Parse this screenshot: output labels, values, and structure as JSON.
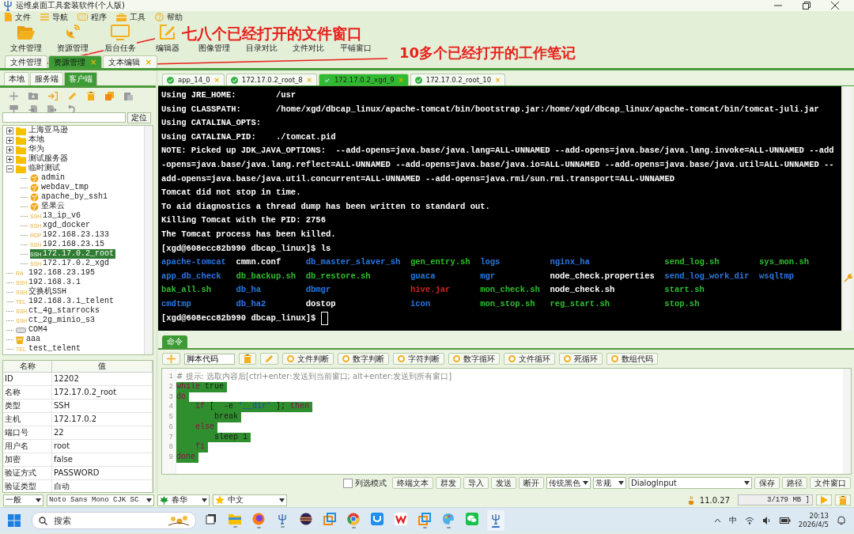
{
  "window": {
    "title": "运维桌面工具套装软件(个人版)"
  },
  "menu": [
    "文件",
    "导航",
    "程序",
    "工具",
    "帮助"
  ],
  "toolbar": [
    "文件管理",
    "资源管理",
    "后台任务",
    "编辑器",
    "图像管理",
    "目录对比",
    "文件对比",
    "平铺窗口"
  ],
  "doc_tabs": [
    {
      "label": "文件管理",
      "selected": false
    },
    {
      "label": "资源管理",
      "selected": true,
      "close": "×"
    },
    {
      "label": "文本编辑",
      "selected": false,
      "close": "×"
    }
  ],
  "annotations": [
    "七八个已经打开的文件窗口",
    "10多个已经打开的工作笔记"
  ],
  "left_panel": {
    "tabs": [
      {
        "label": "本地",
        "selected": false
      },
      {
        "label": "服务端",
        "selected": false
      },
      {
        "label": "客户端",
        "selected": true
      }
    ],
    "locate_button": "定位",
    "tree": [
      {
        "label": "上海亚马逊",
        "kind": "folder",
        "expanded": false,
        "selected": false
      },
      {
        "label": "本地",
        "kind": "folder",
        "expanded": false,
        "selected": false
      },
      {
        "label": "华为",
        "kind": "folder",
        "expanded": false,
        "selected": false
      },
      {
        "label": "测试服务器",
        "kind": "folder",
        "expanded": false,
        "selected": false
      },
      {
        "label": "临时测试",
        "kind": "folder",
        "expanded": true,
        "selected": false,
        "children": [
          {
            "label": "admin",
            "kind": "web",
            "selected": false
          },
          {
            "label": "webdav_tmp",
            "kind": "web",
            "selected": false
          },
          {
            "label": "apache_by_ssh1",
            "kind": "web",
            "selected": false
          },
          {
            "label": "坚果云",
            "kind": "web",
            "selected": false
          },
          {
            "label": "13_ip_v6",
            "kind": "tag",
            "tag": "SSH",
            "selected": false
          },
          {
            "label": "xgd_docker",
            "kind": "tag",
            "tag": "SSH",
            "selected": false
          },
          {
            "label": "192.168.23.133",
            "kind": "tag",
            "tag": "RDP",
            "selected": false
          },
          {
            "label": "192.168.23.15",
            "kind": "tag",
            "tag": "SSH",
            "selected": false
          },
          {
            "label": "172.17.0.2_root",
            "kind": "tag",
            "tag": "SSH",
            "selected": true
          },
          {
            "label": "172.17.0.2_xgd",
            "kind": "tag",
            "tag": "SSH",
            "selected": false
          }
        ]
      },
      {
        "label": "192.168.23.195",
        "kind": "tag",
        "tag": "RA",
        "selected": false
      },
      {
        "label": "192.168.3.1",
        "kind": "tag",
        "tag": "SSH",
        "selected": false
      },
      {
        "label": "交换机SSH",
        "kind": "tag",
        "tag": "SSH",
        "selected": false
      },
      {
        "label": "192.168.3.1_telent",
        "kind": "tag",
        "tag": "TEL",
        "selected": false
      },
      {
        "label": "ct_4g_starrocks",
        "kind": "tag",
        "tag": "SSH",
        "selected": false
      },
      {
        "label": "ct_2g_minio_s3",
        "kind": "tag",
        "tag": "SSH",
        "selected": false
      },
      {
        "label": "COM4",
        "kind": "serial",
        "selected": false
      },
      {
        "label": "aaa",
        "kind": "db",
        "selected": false
      },
      {
        "label": "test_telent",
        "kind": "tag",
        "tag": "TEL",
        "selected": false
      }
    ],
    "properties": {
      "columns": [
        "名称",
        "值"
      ],
      "rows": [
        [
          "ID",
          "12202"
        ],
        [
          "名称",
          "172.17.0.2_root"
        ],
        [
          "类型",
          "SSH"
        ],
        [
          "主机",
          "172.17.0.2"
        ],
        [
          "端口号",
          "22"
        ],
        [
          "用户名",
          "root"
        ],
        [
          "加密",
          "false"
        ],
        [
          "验证方式",
          "PASSWORD"
        ],
        [
          "验证类型",
          "自动"
        ]
      ]
    }
  },
  "session_tabs": [
    {
      "label": "app_14_0",
      "selected": false,
      "close": "×"
    },
    {
      "label": "172.17.0.2_root_8",
      "selected": false,
      "close": "×"
    },
    {
      "label": "172.17.0.2_xgd_9",
      "selected": true,
      "close": "×"
    },
    {
      "label": "172.17.0.2_root_10",
      "selected": false,
      "close": "×"
    }
  ],
  "terminal": {
    "lines": [
      "Using JRE_HOME:        /usr",
      "Using CLASSPATH:       /home/xgd/dbcap_linux/apache-tomcat/bin/bootstrap.jar:/home/xgd/dbcap_linux/apache-tomcat/bin/tomcat-juli.jar",
      "Using CATALINA_OPTS:",
      "Using CATALINA_PID:    ./tomcat.pid",
      "NOTE: Picked up JDK_JAVA_OPTIONS:  --add-opens=java.base/java.lang=ALL-UNNAMED --add-opens=java.base/java.lang.invoke=ALL-UNNAMED --add",
      "-opens=java.base/java.lang.reflect=ALL-UNNAMED --add-opens=java.base/java.io=ALL-UNNAMED --add-opens=java.base/java.util=ALL-UNNAMED --",
      "add-opens=java.base/java.util.concurrent=ALL-UNNAMED --add-opens=java.rmi/sun.rmi.transport=ALL-UNNAMED",
      "Tomcat did not stop in time.",
      "To aid diagnostics a thread dump has been written to standard out.",
      "Killing Tomcat with the PID: 2756",
      "The Tomcat process has been killed.",
      "[xgd@608ecc82b990 dbcap_linux]$ ls"
    ],
    "listing": [
      [
        {
          "name": "apache-tomcat",
          "color": "#2a78e4"
        },
        {
          "name": "cmmn.conf",
          "color": "#ffffff"
        },
        {
          "name": "db_master_slaver_sh",
          "color": "#2a78e4"
        },
        {
          "name": "gen_entry.sh",
          "color": "#2fbf2f"
        },
        {
          "name": "logs",
          "color": "#2a78e4"
        },
        {
          "name": "nginx_ha",
          "color": "#2a78e4"
        },
        {
          "name": "send_log.sh",
          "color": "#2fbf2f"
        },
        {
          "name": "sys_mon.sh",
          "color": "#2fbf2f"
        }
      ],
      [
        {
          "name": "app_db_check",
          "color": "#2a78e4"
        },
        {
          "name": "db_backup.sh",
          "color": "#2fbf2f"
        },
        {
          "name": "db_restore.sh",
          "color": "#2fbf2f"
        },
        {
          "name": "guaca",
          "color": "#2a78e4"
        },
        {
          "name": "mgr",
          "color": "#2a78e4"
        },
        {
          "name": "node_check.properties",
          "color": "#ffffff"
        },
        {
          "name": "send_log_work_dir",
          "color": "#2a78e4"
        },
        {
          "name": "wsqltmp",
          "color": "#2a78e4"
        }
      ],
      [
        {
          "name": "bak_all.sh",
          "color": "#2fbf2f"
        },
        {
          "name": "db_ha",
          "color": "#2a78e4"
        },
        {
          "name": "dbmgr",
          "color": "#2a78e4"
        },
        {
          "name": "hive.jar",
          "color": "#d42020"
        },
        {
          "name": "mon_check.sh",
          "color": "#2fbf2f"
        },
        {
          "name": "node_check.sh",
          "color": "#ffffff"
        },
        {
          "name": "start.sh",
          "color": "#2fbf2f"
        }
      ],
      [
        {
          "name": "cmdtmp",
          "color": "#2a78e4"
        },
        {
          "name": "db_ha2",
          "color": "#2a78e4"
        },
        {
          "name": "dostop",
          "color": "#ffffff"
        },
        {
          "name": "icon",
          "color": "#2a78e4"
        },
        {
          "name": "mon_stop.sh",
          "color": "#2fbf2f"
        },
        {
          "name": "reg_start.sh",
          "color": "#2fbf2f"
        },
        {
          "name": "stop.sh",
          "color": "#2fbf2f"
        }
      ]
    ],
    "prompt": "[xgd@608ecc82b990 dbcap_linux]$ "
  },
  "command": {
    "tab": "命令",
    "script_field": "脚本代码",
    "snippets": [
      "文件判断",
      "数字判断",
      "字符判断",
      "数字循环",
      "文件循环",
      "死循环",
      "数组代码"
    ],
    "code": [
      {
        "number": "1",
        "selected": false,
        "tokens": [
          {
            "text": "# 提示: 选取内容后[ctrl+enter:发送到当前窗口; alt+enter:发送到所有窗口]",
            "kind": "comment"
          }
        ]
      },
      {
        "number": "2",
        "selected": true,
        "tokens": [
          {
            "text": "while",
            "kind": "keyword"
          },
          {
            "text": " true",
            "kind": "plain"
          }
        ]
      },
      {
        "number": "3",
        "selected": true,
        "tokens": [
          {
            "text": "do",
            "kind": "keyword"
          }
        ]
      },
      {
        "number": "4",
        "selected": true,
        "tokens": [
          {
            "text": "    if",
            "kind": "keyword"
          },
          {
            "text": " [  -e ",
            "kind": "plain"
          },
          {
            "text": "'__dir'",
            "kind": "string"
          },
          {
            "text": " ]; ",
            "kind": "plain"
          },
          {
            "text": "then",
            "kind": "keyword"
          }
        ]
      },
      {
        "number": "5",
        "selected": true,
        "tokens": [
          {
            "text": "        break",
            "kind": "plain"
          }
        ]
      },
      {
        "number": "6",
        "selected": true,
        "tokens": [
          {
            "text": "    else",
            "kind": "keyword"
          }
        ]
      },
      {
        "number": "7",
        "selected": true,
        "tokens": [
          {
            "text": "        sleep 1",
            "kind": "plain"
          }
        ]
      },
      {
        "number": "8",
        "selected": true,
        "tokens": [
          {
            "text": "    fi",
            "kind": "keyword"
          }
        ]
      },
      {
        "number": "9",
        "selected": true,
        "tokens": [
          {
            "text": "done",
            "kind": "keyword"
          }
        ]
      }
    ],
    "column_mode": {
      "label": "列选模式",
      "checked": false
    },
    "buttons": [
      "终端文本",
      "群发",
      "导入",
      "发送",
      "断开"
    ],
    "theme": "传统黑色",
    "style": "常规",
    "font": "DialogInput",
    "buttons_right": [
      "保存",
      "路径",
      "文件窗口"
    ]
  },
  "status_bar": {
    "combos": [
      "一般",
      "Noto Sans Mono CJK SC",
      "春华",
      "中文"
    ],
    "version": "11.0.27",
    "memory": "3/179 MB ]"
  },
  "taskbar": {
    "search_placeholder": "搜索",
    "apps": [
      {
        "running": false,
        "selected": false
      },
      {
        "running": true,
        "selected": false
      },
      {
        "running": true,
        "selected": false
      },
      {
        "running": true,
        "selected": false
      },
      {
        "running": false,
        "selected": false
      },
      {
        "running": false,
        "selected": false
      },
      {
        "running": true,
        "selected": false
      },
      {
        "running": false,
        "selected": false
      },
      {
        "running": false,
        "selected": false
      },
      {
        "running": true,
        "selected": false
      },
      {
        "running": true,
        "selected": false
      },
      {
        "running": false,
        "selected": false
      },
      {
        "running": true,
        "selected": true
      }
    ],
    "ime": "中",
    "time": "20:13",
    "date": "2026/4/5"
  }
}
